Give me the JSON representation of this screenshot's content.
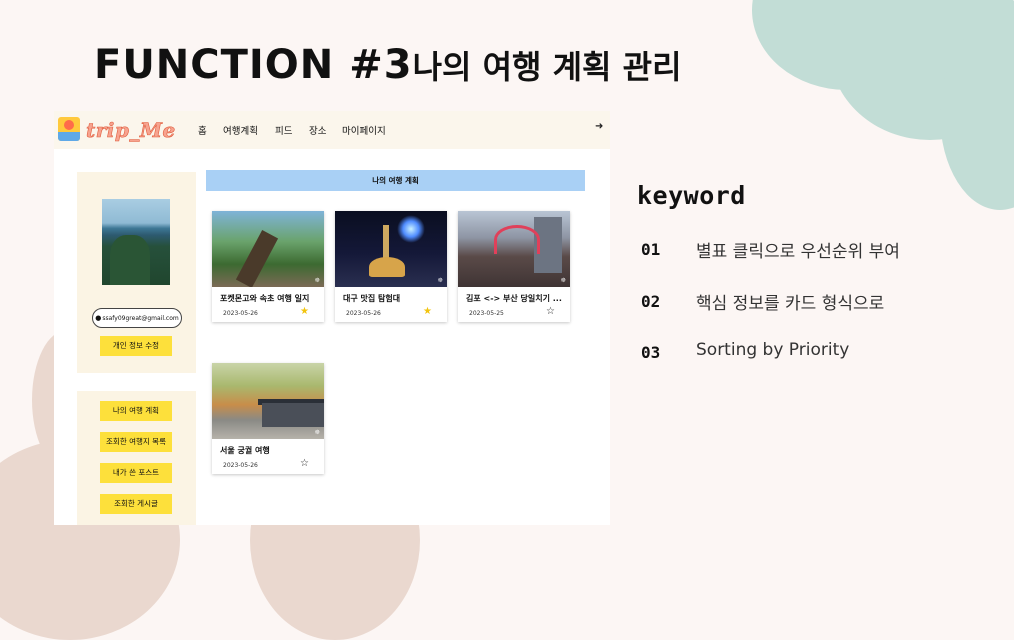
{
  "slide": {
    "title": "FUNCTION #3",
    "title_sub": "나의 여행 계획 관리"
  },
  "app": {
    "logo": "trip_Me",
    "nav": [
      "홈",
      "여행계획",
      "피드",
      "장소",
      "마이페이지"
    ],
    "logout_icon": "logout-icon"
  },
  "sidebar": {
    "email": "ssafy09great@gmail.com",
    "edit_profile": "개인 정보 수정",
    "menu": [
      "나의 여행 계획",
      "조회한 여행지 목록",
      "내가 쓴 포스트",
      "조회한 게시글"
    ]
  },
  "main": {
    "banner": "나의 여행 계획",
    "cards": [
      {
        "title": "포켓몬고와 속초 여행 일지",
        "date": "2023-05-26",
        "starred": true
      },
      {
        "title": "대구 맛집 탐험대",
        "date": "2023-05-26",
        "starred": true
      },
      {
        "title": "김포 <-> 부산 당일치기 ...",
        "date": "2023-05-25",
        "starred": false
      },
      {
        "title": "서울 궁궐 여행",
        "date": "2023-05-26",
        "starred": false
      }
    ]
  },
  "keywords": {
    "heading": "keyword",
    "items": [
      {
        "num": "01",
        "text": "별표 클릭으로 우선순위 부여"
      },
      {
        "num": "02",
        "text": "핵심 정보를 카드 형식으로"
      },
      {
        "num": "03",
        "text": "Sorting by Priority"
      }
    ]
  },
  "colors": {
    "accent_yellow": "#fde03b",
    "banner_blue": "#a9d0f5",
    "star_yellow": "#f2c40f",
    "blob_green": "#c2ddd6",
    "blob_beige": "#ead8cf"
  }
}
